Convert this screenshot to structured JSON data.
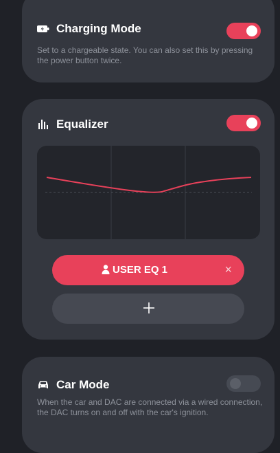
{
  "charging": {
    "title": "Charging Mode",
    "description": "Set to a chargeable state. You can also set this by pressing the power button twice.",
    "enabled": true,
    "icon": "battery-icon"
  },
  "equalizer": {
    "title": "Equalizer",
    "enabled": true,
    "icon": "equalizer-bars-icon",
    "curve_color": "#e8415a",
    "preset": {
      "label": "USER EQ 1",
      "close_glyph": "×",
      "icon": "user-icon"
    },
    "add_icon": "plus-icon"
  },
  "car": {
    "title": "Car Mode",
    "description": "When the car and DAC are connected via a wired connection, the DAC turns on and off with the car's ignition.",
    "enabled": false,
    "icon": "car-icon"
  },
  "colors": {
    "accent": "#e8415a",
    "card": "#34373f",
    "background": "#1f2127"
  }
}
